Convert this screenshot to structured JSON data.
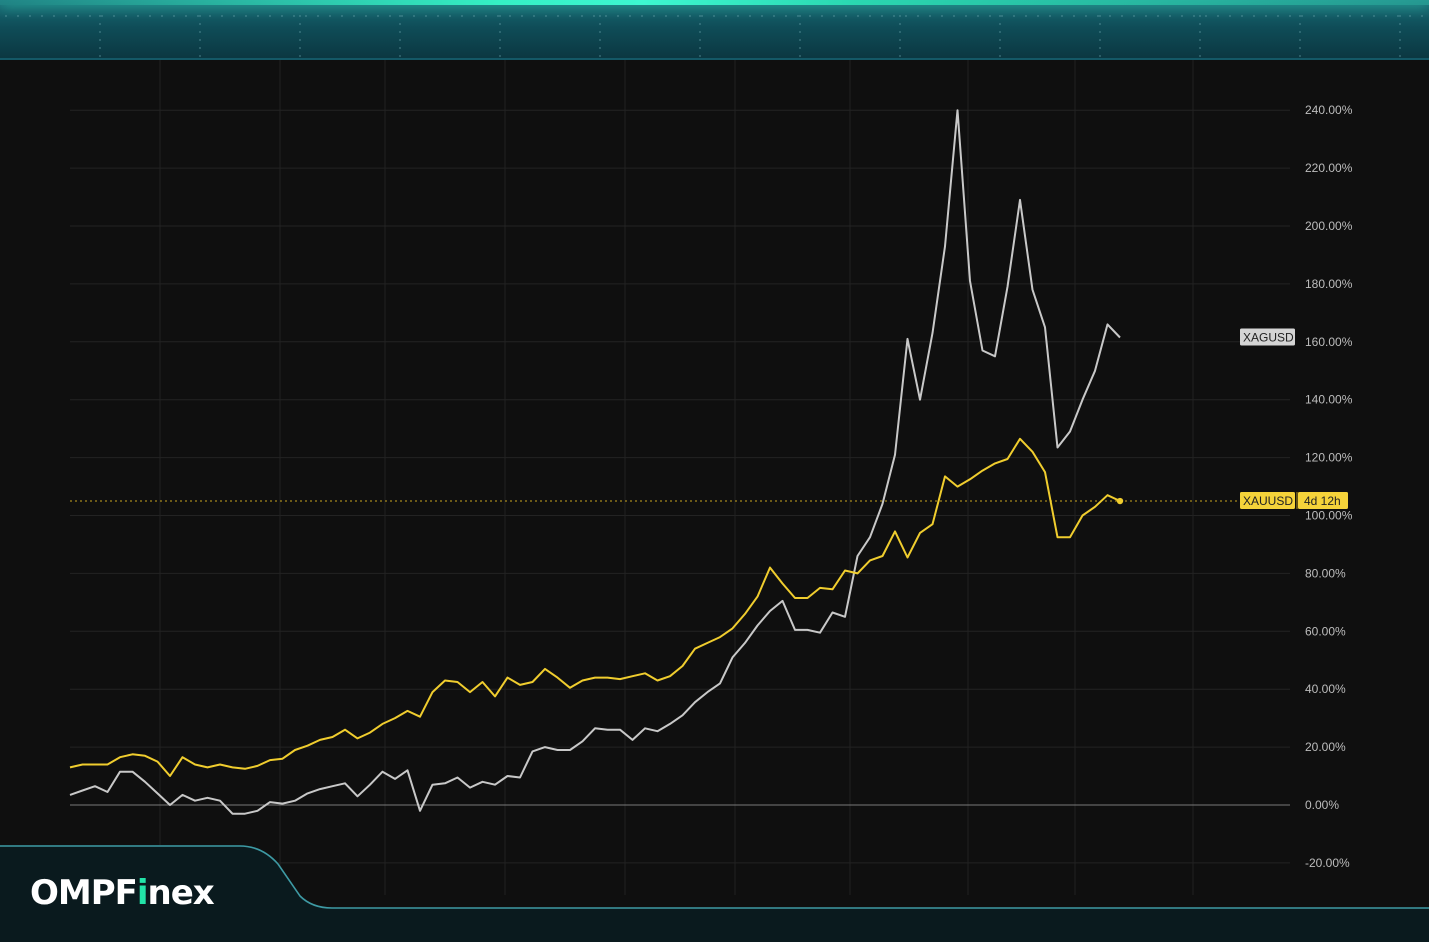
{
  "brand": {
    "prefix": "OMPF",
    "accent": "i",
    "suffix": "nex",
    "accent_color": "#22e3a8"
  },
  "chart_data": {
    "type": "line",
    "y_unit": "%",
    "ylim": [
      -20,
      240
    ],
    "y_ticks": [
      240,
      220,
      200,
      180,
      160,
      140,
      120,
      100,
      80,
      60,
      40,
      20,
      0,
      -20
    ],
    "y_tick_labels": [
      "240.00%",
      "220.00%",
      "200.00%",
      "180.00%",
      "160.00%",
      "140.00%",
      "120.00%",
      "100.00%",
      "80.00%",
      "60.00%",
      "40.00%",
      "20.00%",
      "0.00%",
      "-20.00%"
    ],
    "grid": true,
    "zero_line": true,
    "series": [
      {
        "name": "XAGUSD",
        "color": "#c8c8c8",
        "label_bg": "#d4d4d4",
        "label_color": "#222222",
        "values": [
          3.5,
          5,
          6.5,
          4.5,
          11.5,
          11.5,
          8,
          4,
          0,
          3.5,
          1.5,
          2.5,
          1.5,
          -3,
          -3,
          -2,
          1,
          0.5,
          1.5,
          4,
          5.5,
          6.5,
          7.5,
          3,
          7,
          11.5,
          9,
          12,
          -2,
          7,
          7.5,
          9.5,
          6,
          8,
          7,
          10,
          9.5,
          18.5,
          20,
          19,
          19,
          22,
          26.5,
          26,
          26,
          22.5,
          26.5,
          25.5,
          28,
          31,
          35.5,
          39,
          42,
          51,
          56,
          62,
          67,
          70.5,
          60.5,
          60.5,
          59.5,
          66.5,
          65,
          86,
          92.5,
          104,
          121,
          161,
          140,
          163,
          193,
          240,
          181,
          157,
          155,
          179,
          209,
          178,
          165,
          123.5,
          129,
          140,
          150,
          166,
          161.5
        ]
      },
      {
        "name": "XAUUSD",
        "color": "#f0cd2e",
        "label_bg": "#f5d33a",
        "label_color": "#222222",
        "values": [
          13,
          14,
          14,
          14,
          16.5,
          17.5,
          17,
          15,
          10,
          16.5,
          14,
          13,
          14,
          13,
          12.5,
          13.5,
          15.5,
          16,
          19,
          20.5,
          22.5,
          23.5,
          26,
          23,
          25,
          28,
          30,
          32.5,
          30.5,
          39,
          43,
          42.5,
          39,
          42.5,
          37.5,
          44,
          41.5,
          42.5,
          47,
          44,
          40.5,
          43,
          44,
          44,
          43.5,
          44.5,
          45.5,
          43,
          44.5,
          48,
          54,
          56,
          58,
          61,
          66,
          72,
          82,
          76.5,
          71.5,
          71.5,
          75,
          74.5,
          81,
          80,
          84.5,
          86,
          94.5,
          85.5,
          94,
          97,
          113.5,
          110,
          112.5,
          115.5,
          118,
          119.5,
          126.5,
          122,
          115,
          92.5,
          92.5,
          100,
          103,
          107,
          105
        ]
      }
    ],
    "last_value_line": 105,
    "countdown": "4d 12h"
  }
}
